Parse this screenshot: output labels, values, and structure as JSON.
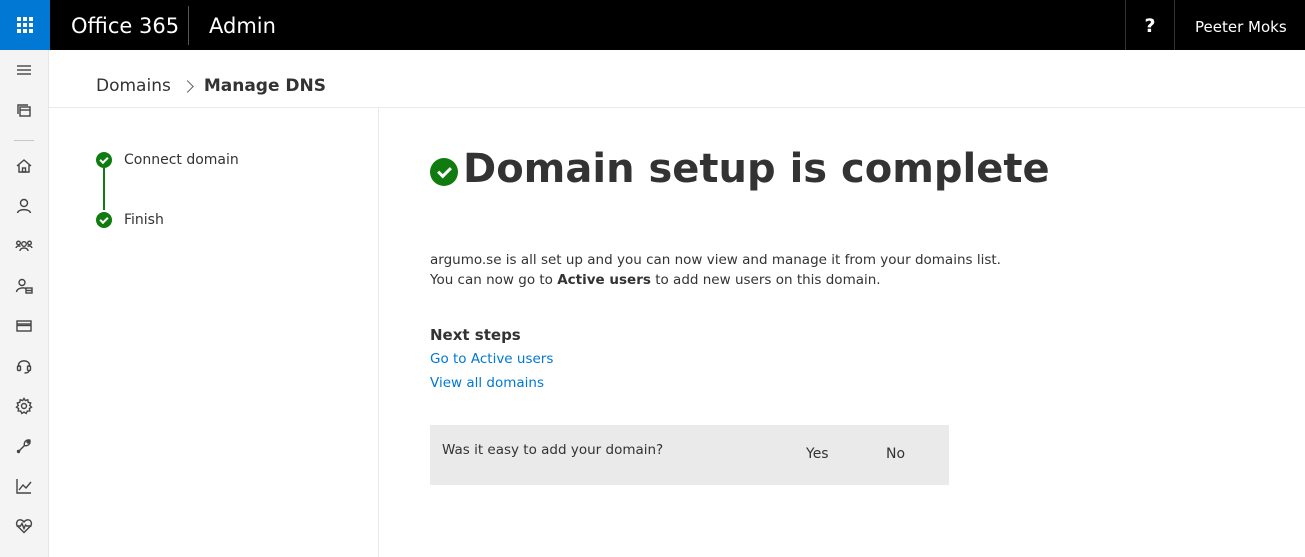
{
  "topbar": {
    "app_title": "Office 365",
    "app_section": "Admin",
    "help_label": "?",
    "user_name": "Peeter Moks"
  },
  "leftnav": {
    "icons": [
      "menu-icon",
      "dashboard-icon",
      "home-icon",
      "user-icon",
      "groups-icon",
      "resources-icon",
      "billing-icon",
      "support-icon",
      "settings-icon",
      "setup-icon",
      "reports-icon",
      "health-icon"
    ]
  },
  "breadcrumb": {
    "parent": "Domains",
    "current": "Manage DNS"
  },
  "steps": [
    {
      "label": "Connect domain",
      "status": "complete"
    },
    {
      "label": "Finish",
      "status": "complete"
    }
  ],
  "main": {
    "title": "Domain setup is complete",
    "desc_line1": "argumo.se is all set up and you can now view and manage it from your domains list.",
    "desc_line2_prefix": "You can now go to ",
    "desc_line2_bold": "Active users",
    "desc_line2_suffix": " to add new users on this domain.",
    "next_steps_heading": "Next steps",
    "links": [
      "Go to Active users",
      "View all domains"
    ]
  },
  "feedback": {
    "question": "Was it easy to add your domain?",
    "yes": "Yes",
    "no": "No"
  },
  "colors": {
    "accent": "#0078d4",
    "success": "#107c10",
    "topbar": "#000000"
  }
}
